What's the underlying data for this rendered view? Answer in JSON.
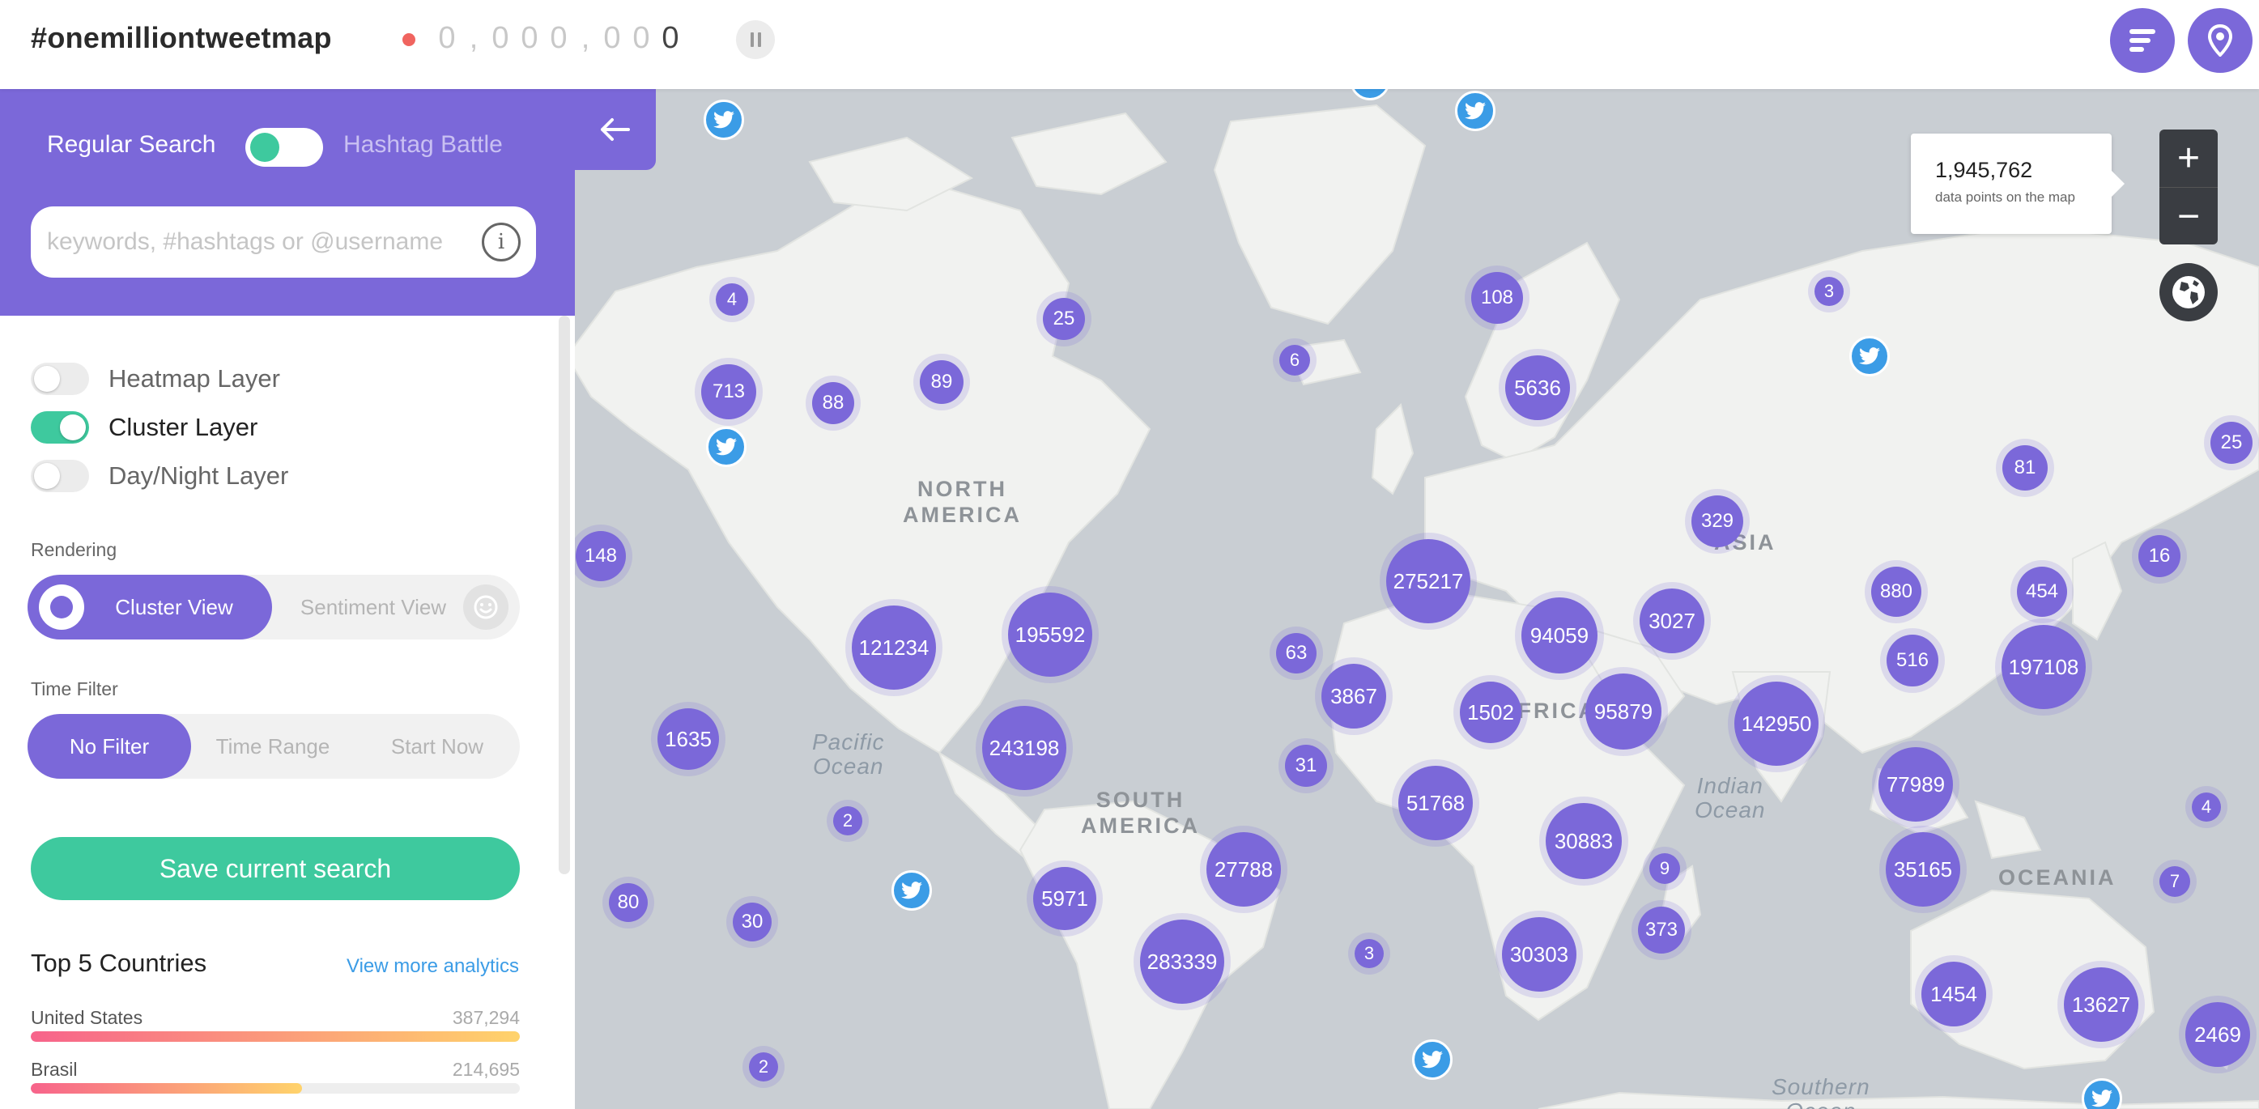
{
  "header": {
    "brand": "#onemilliontweetmap",
    "counter_digits": [
      "0",
      ",",
      "0",
      "0",
      "0",
      ",",
      "0",
      "0",
      "0"
    ],
    "counter_last": "0"
  },
  "search": {
    "mode_left": "Regular Search",
    "mode_right": "Hashtag Battle",
    "placeholder": "keywords, #hashtags or @username",
    "info": "i"
  },
  "layers": [
    {
      "label": "Heatmap Layer",
      "on": false
    },
    {
      "label": "Cluster Layer",
      "on": true
    },
    {
      "label": "Day/Night Layer",
      "on": false
    }
  ],
  "rendering": {
    "label": "Rendering",
    "options": [
      "Cluster View",
      "Sentiment View"
    ],
    "selected": "Cluster View"
  },
  "time_filter": {
    "label": "Time Filter",
    "options": [
      "No Filter",
      "Time Range",
      "Start Now"
    ],
    "selected": "No Filter"
  },
  "save_label": "Save current search",
  "top_countries": {
    "title": "Top 5 Countries",
    "link": "View more analytics",
    "items": [
      {
        "name": "United States",
        "value": "387,294",
        "fraction": 1.0
      },
      {
        "name": "Brasil",
        "value": "214,695",
        "fraction": 0.554
      }
    ]
  },
  "map": {
    "tooltip_count": "1,945,762",
    "tooltip_label": "data points on the map",
    "zoom_in": "+",
    "zoom_out": "−",
    "region_labels": [
      "NORTH\nAMERICA",
      "SOUTH\nAMERICA",
      "AFRICA",
      "ASIA",
      "OCEANIA"
    ],
    "ocean_labels": [
      "Pacific\nOcean",
      "Indian\nOcean",
      "Southern\nOcean"
    ],
    "clusters": [
      "4",
      "25",
      "713",
      "88",
      "89",
      "148",
      "108",
      "6",
      "3",
      "5636",
      "329",
      "81",
      "25",
      "16",
      "880",
      "454",
      "275217",
      "121234",
      "195592",
      "63",
      "94059",
      "3027",
      "516",
      "197108",
      "1635",
      "3867",
      "1502",
      "95879",
      "142950",
      "243198",
      "31",
      "51768",
      "77989",
      "4",
      "2",
      "30883",
      "9",
      "35165",
      "27788",
      "7",
      "80",
      "30",
      "5971",
      "373",
      "283339",
      "3",
      "30303",
      "1454",
      "13627",
      "2469",
      "2"
    ],
    "colors": {
      "cluster": "#7b68d9",
      "land": "#f1f2f0",
      "water": "#c9ced3",
      "twitter": "#3b9ce6",
      "accent_green": "#3ec99e"
    }
  }
}
